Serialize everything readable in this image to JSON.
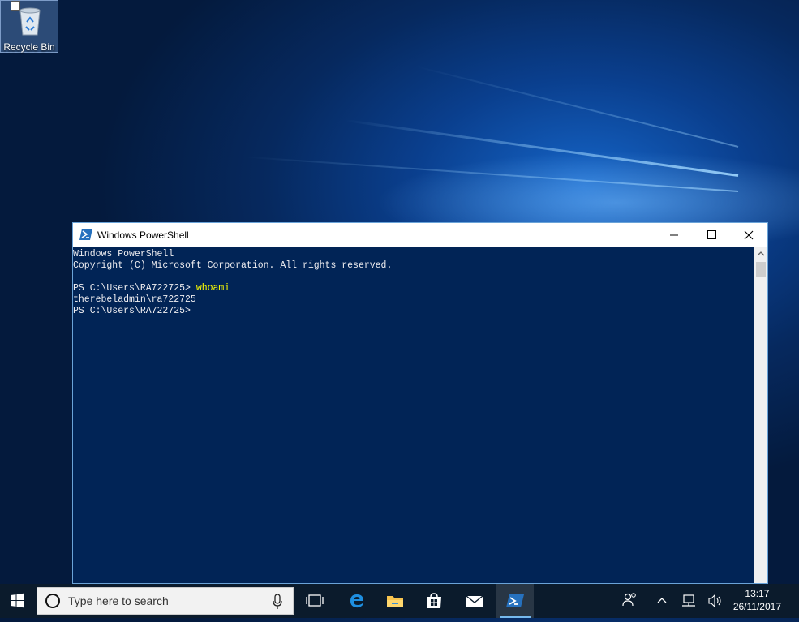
{
  "desktop": {
    "icons": [
      {
        "label": "Recycle Bin",
        "icon": "recycle-bin-icon"
      }
    ]
  },
  "window": {
    "title": "Windows PowerShell",
    "controls": {
      "minimize": "minimize-icon",
      "maximize": "maximize-icon",
      "close": "close-icon"
    },
    "console": {
      "lines": [
        "Windows PowerShell",
        "Copyright (C) Microsoft Corporation. All rights reserved.",
        "",
        "PS C:\\Users\\RA722725> ",
        "therebeladmin\\ra722725",
        "PS C:\\Users\\RA722725>"
      ],
      "command": "whoami"
    },
    "colors": {
      "console_bg": "#012456",
      "console_fg": "#eeedf0",
      "command": "#ffff00"
    }
  },
  "taskbar": {
    "search_placeholder": "Type here to search",
    "apps": [
      "task-view-icon",
      "edge-icon",
      "file-explorer-icon",
      "store-icon",
      "mail-icon",
      "powershell-icon"
    ],
    "active_app": "powershell-icon",
    "tray": [
      "people-icon",
      "chevron-up-icon",
      "network-icon",
      "volume-icon"
    ],
    "time": "13:17",
    "date": "26/11/2017"
  }
}
